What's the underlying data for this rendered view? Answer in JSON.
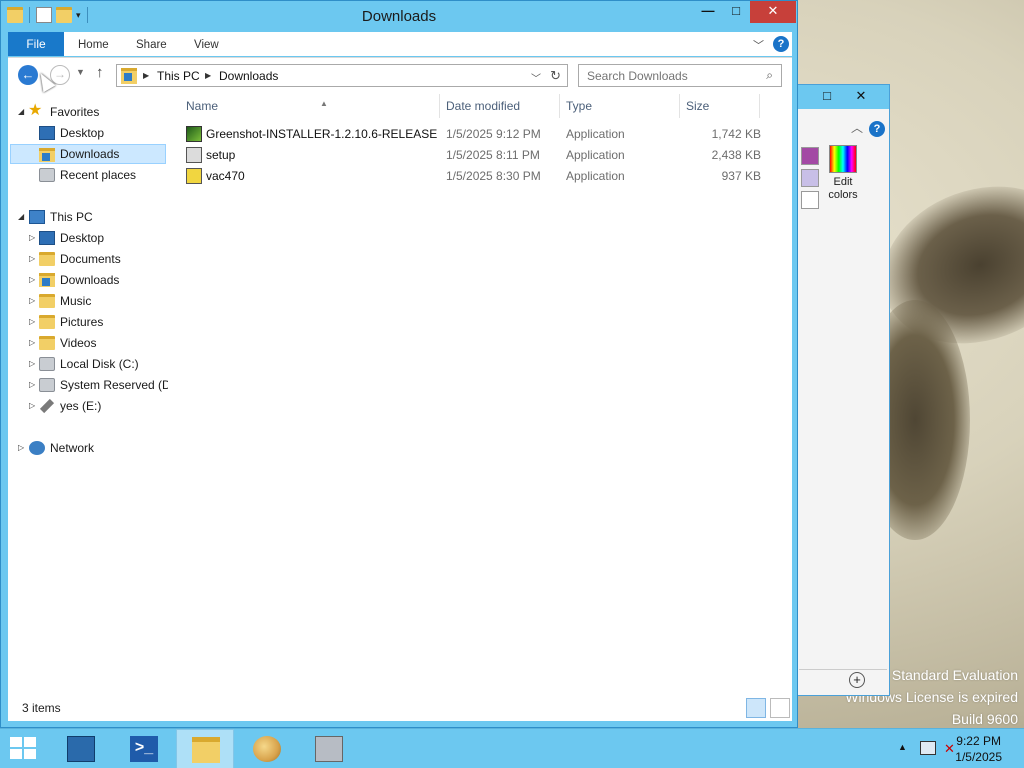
{
  "window": {
    "title": "Downloads",
    "controls": {
      "minimize": "—",
      "maximize": "□",
      "close": "✕"
    }
  },
  "ribbon": {
    "tabs": [
      "File",
      "Home",
      "Share",
      "View"
    ],
    "help": "?"
  },
  "navbar": {
    "breadcrumb": [
      "This PC",
      "Downloads"
    ],
    "search_placeholder": "Search Downloads"
  },
  "nav_pane": {
    "favorites_header": "Favorites",
    "favorites": [
      {
        "label": "Desktop",
        "icon": "desktop-icon"
      },
      {
        "label": "Downloads",
        "icon": "downloads-folder-icon",
        "selected": true
      },
      {
        "label": "Recent places",
        "icon": "recent-places-icon"
      }
    ],
    "thispc_header": "This PC",
    "thispc": [
      {
        "label": "Desktop",
        "icon": "desktop-icon"
      },
      {
        "label": "Documents",
        "icon": "documents-folder-icon"
      },
      {
        "label": "Downloads",
        "icon": "downloads-folder-icon"
      },
      {
        "label": "Music",
        "icon": "music-folder-icon"
      },
      {
        "label": "Pictures",
        "icon": "pictures-folder-icon"
      },
      {
        "label": "Videos",
        "icon": "videos-folder-icon"
      },
      {
        "label": "Local Disk (C:)",
        "icon": "local-disk-icon"
      },
      {
        "label": "System Reserved (D:",
        "icon": "drive-icon"
      },
      {
        "label": "yes (E:)",
        "icon": "usb-drive-icon"
      }
    ],
    "network_header": "Network"
  },
  "file_list": {
    "columns": [
      "Name",
      "Date modified",
      "Type",
      "Size"
    ],
    "rows": [
      {
        "name": "Greenshot-INSTALLER-1.2.10.6-RELEASE",
        "date": "1/5/2025 9:12 PM",
        "type": "Application",
        "size": "1,742 KB",
        "icon": "greenshot-app-icon"
      },
      {
        "name": "setup",
        "date": "1/5/2025 8:11 PM",
        "type": "Application",
        "size": "2,438 KB",
        "icon": "setup-app-icon"
      },
      {
        "name": "vac470",
        "date": "1/5/2025 8:30 PM",
        "type": "Application",
        "size": "937 KB",
        "icon": "vac-app-icon"
      }
    ]
  },
  "status": {
    "item_count": "3 items"
  },
  "background_window": {
    "edit_colors_line1": "Edit",
    "edit_colors_line2": "colors"
  },
  "desktop": {
    "watermark_line1": "Standard Evaluation",
    "watermark_line2": "Windows License is expired",
    "watermark_line3": "Build 9600"
  },
  "taskbar": {
    "time": "9:22 PM",
    "date": "1/5/2025",
    "apps": [
      "server-manager-icon",
      "powershell-icon",
      "file-explorer-icon",
      "paint-icon",
      "tools-icon"
    ]
  },
  "colors": {
    "titlebar": "#6cc8f0",
    "accent": "#1979ca",
    "selection": "#cce8ff",
    "close": "#c7403a"
  }
}
